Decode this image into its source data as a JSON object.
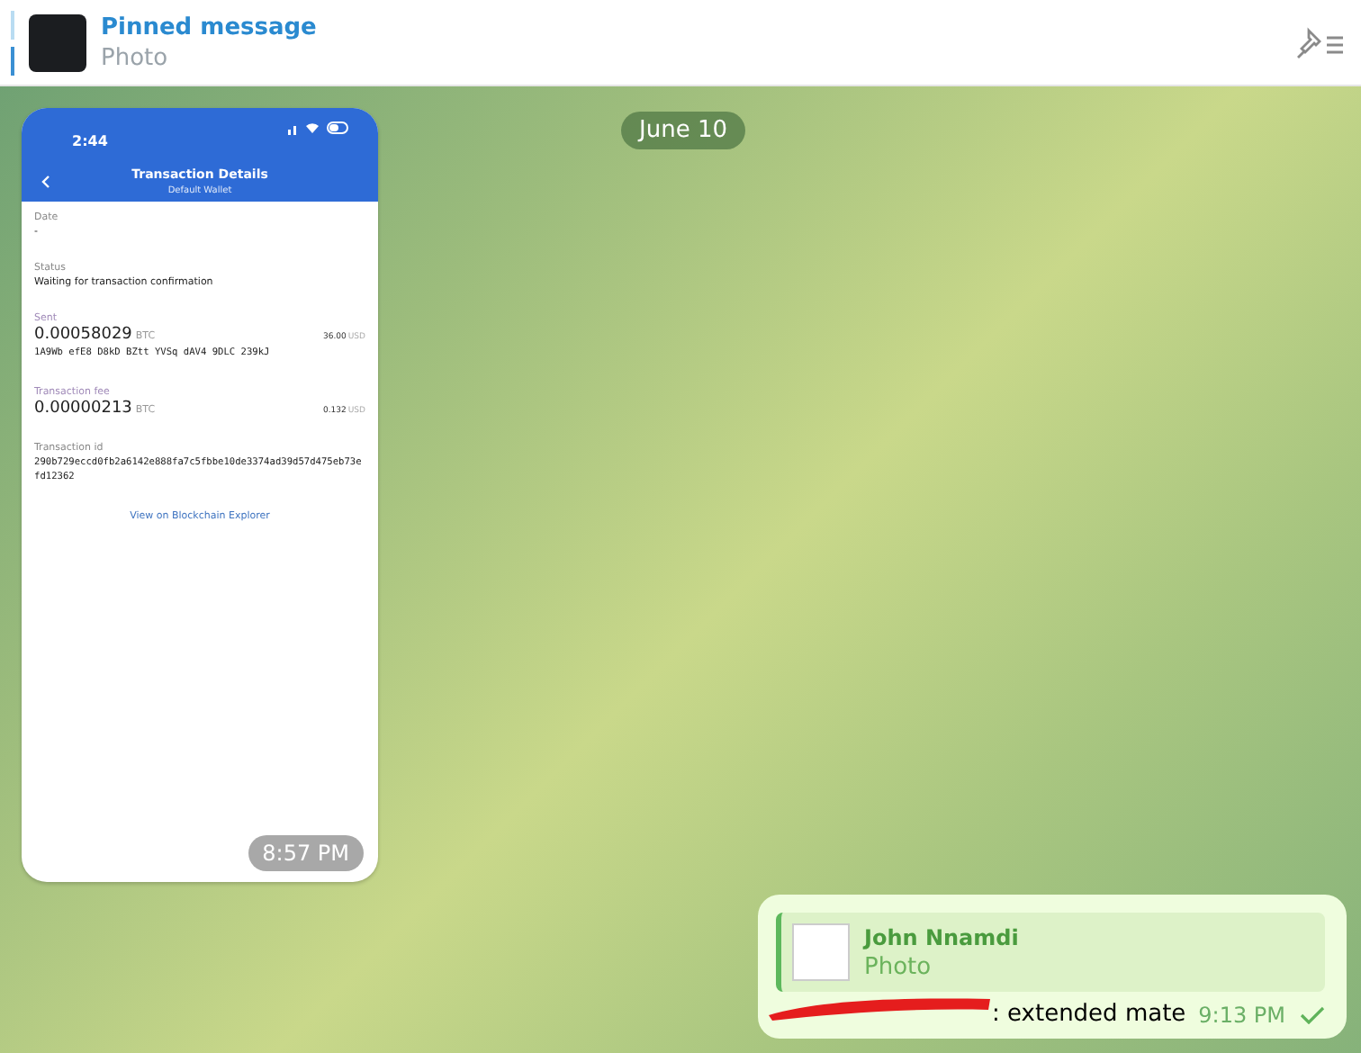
{
  "pinned": {
    "title": "Pinned message",
    "subtitle": "Photo"
  },
  "date_pill": "June 10",
  "photo_message": {
    "time": "8:57 PM",
    "screenshot": {
      "clock": "2:44",
      "title": "Transaction Details",
      "subtitle": "Default Wallet",
      "fields": [
        {
          "kind": "text",
          "label": "Date",
          "value": "-"
        },
        {
          "kind": "text",
          "label": "Status",
          "value": "Waiting for transaction confirmation"
        },
        {
          "kind": "amount",
          "label": "Sent",
          "value": "0.00058029",
          "unit": "BTC",
          "fiat": "36.00",
          "fiat_unit": "USD",
          "detail": "1A9Wb efE8 D8kD BZtt YVSq dAV4 9DLC 239kJ"
        },
        {
          "kind": "amount",
          "label": "Transaction fee",
          "value": "0.00000213",
          "unit": "BTC",
          "fiat": "0.132",
          "fiat_unit": "USD"
        },
        {
          "kind": "mono",
          "label": "Transaction id",
          "value": "290b729eccd0fb2a6142e888fa7c5fbbe10de3374ad39d57d475eb73efd12362"
        }
      ],
      "link": "View on Blockchain Explorer"
    }
  },
  "reply_message": {
    "quote_author": "John Nnamdi",
    "quote_text": "Photo",
    "text": ": extended mate",
    "time": "9:13 PM",
    "read": true
  }
}
